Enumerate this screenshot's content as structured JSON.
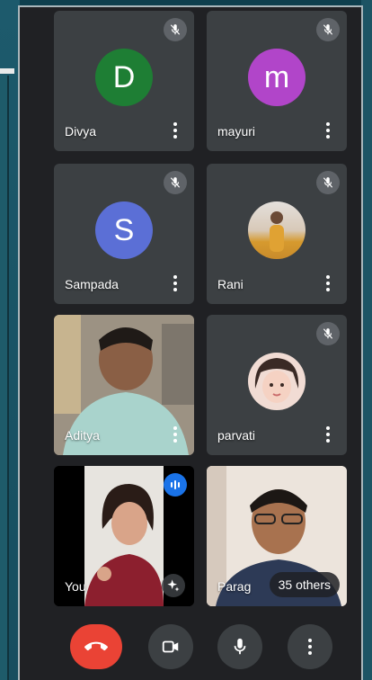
{
  "participants": [
    {
      "name": "Divya",
      "initial": "D",
      "avatar_color": "#1e7e34",
      "muted": true
    },
    {
      "name": "mayuri",
      "initial": "m",
      "avatar_color": "#b145c9",
      "muted": true
    },
    {
      "name": "Sampada",
      "initial": "S",
      "avatar_color": "#5b6fd6",
      "muted": true
    },
    {
      "name": "Rani",
      "muted": true,
      "avatar": "photo"
    },
    {
      "name": "Aditya",
      "muted": false,
      "video": true
    },
    {
      "name": "parvati",
      "muted": true,
      "avatar": "photo"
    },
    {
      "name": "You",
      "muted": false,
      "video": true,
      "speaking": true
    },
    {
      "name": "Parag",
      "muted": false,
      "video": true
    }
  ],
  "others_label": "35 others",
  "controls": {
    "end_call": "end-call-icon",
    "camera": "video-camera-icon",
    "mic": "microphone-icon",
    "more": "more-options-icon"
  },
  "colors": {
    "background": "#202124",
    "tile": "#3c4043",
    "end_call": "#ea4335",
    "speaking": "#1a73e8"
  }
}
